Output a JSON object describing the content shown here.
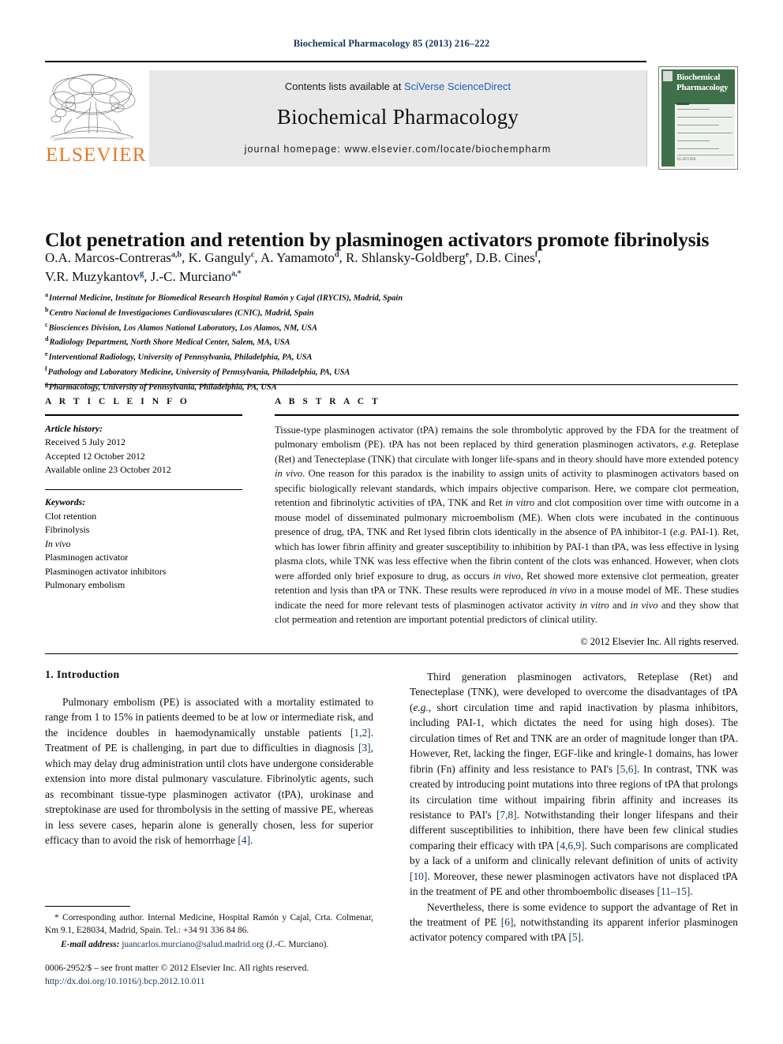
{
  "runhead": "Biochemical Pharmacology 85 (2013) 216–222",
  "masthead": {
    "contents_prefix": "Contents lists available at ",
    "contents_link": "SciVerse ScienceDirect",
    "journal_title": "Biochemical Pharmacology",
    "homepage": "journal homepage: www.elsevier.com/locate/biochempharm",
    "publisher_wordmark": "ELSEVIER",
    "publisher_logo_color": "#e87722"
  },
  "cover": {
    "title_line1": "Biochemical",
    "title_line2": "Pharmacology",
    "accent_color": "#3f7049",
    "imprint": "ELSEVIER"
  },
  "article": {
    "title": "Clot penetration and retention by plasminogen activators promote fibrinolysis",
    "authors_line1_names": [
      {
        "name": "O.A. Marcos-Contreras",
        "sup": "a,b"
      },
      {
        "name": "K. Ganguly",
        "sup": "c"
      },
      {
        "name": "A. Yamamoto",
        "sup": "d"
      },
      {
        "name": "R. Shlansky-Goldberg",
        "sup": "e"
      },
      {
        "name": "D.B. Cines",
        "sup": "f"
      }
    ],
    "authors_line2_names": [
      {
        "name": "V.R. Muzykantov",
        "sup": "g"
      },
      {
        "name": "J.-C. Murciano",
        "sup": "a,*"
      }
    ],
    "affiliations": [
      {
        "mark": "a",
        "text": "Internal Medicine, Institute for Biomedical Research Hospital Ramón y Cajal (IRYCIS), Madrid, Spain"
      },
      {
        "mark": "b",
        "text": "Centro Nacional de Investigaciones Cardiovasculares (CNIC), Madrid, Spain"
      },
      {
        "mark": "c",
        "text": "Biosciences Division, Los Alamos National Laboratory, Los Alamos, NM, USA"
      },
      {
        "mark": "d",
        "text": "Radiology Department, North Shore Medical Center, Salem, MA, USA"
      },
      {
        "mark": "e",
        "text": "Interventional Radiology, University of Pennsylvania, Philadelphia, PA, USA"
      },
      {
        "mark": "f",
        "text": "Pathology and Laboratory Medicine, University of Pennsylvania, Philadelphia, PA, USA"
      },
      {
        "mark": "g",
        "text": "Pharmacology, University of Pennsylvania, Philadelphia, PA, USA"
      }
    ]
  },
  "info": {
    "heading": "A R T I C L E  I N F O",
    "history_label": "Article history:",
    "history": [
      "Received 5 July 2012",
      "Accepted 12 October 2012",
      "Available online 23 October 2012"
    ],
    "keywords_label": "Keywords:",
    "keywords": [
      "Clot retention",
      "Fibrinolysis",
      "In vivo",
      "Plasminogen activator",
      "Plasminogen activator inhibitors",
      "Pulmonary embolism"
    ]
  },
  "abstract": {
    "heading": "A B S T R A C T",
    "text": "Tissue-type plasminogen activator (tPA) remains the sole thrombolytic approved by the FDA for the treatment of pulmonary embolism (PE). tPA has not been replaced by third generation plasminogen activators, e.g. Reteplase (Ret) and Tenecteplase (TNK) that circulate with longer life-spans and in theory should have more extended potency in vivo. One reason for this paradox is the inability to assign units of activity to plasminogen activators based on specific biologically relevant standards, which impairs objective comparison. Here, we compare clot permeation, retention and fibrinolytic activities of tPA, TNK and Ret in vitro and clot composition over time with outcome in a mouse model of disseminated pulmonary microembolism (ME). When clots were incubated in the continuous presence of drug, tPA, TNK and Ret lysed fibrin clots identically in the absence of PA inhibitor-1 (e.g. PAI-1). Ret, which has lower fibrin affinity and greater susceptibility to inhibition by PAI-1 than tPA, was less effective in lysing plasma clots, while TNK was less effective when the fibrin content of the clots was enhanced. However, when clots were afforded only brief exposure to drug, as occurs in vivo, Ret showed more extensive clot permeation, greater retention and lysis than tPA or TNK. These results were reproduced in vivo in a mouse model of ME. These studies indicate the need for more relevant tests of plasminogen activator activity in vitro and in vivo and they show that clot permeation and retention are important potential predictors of clinical utility.",
    "copyright": "© 2012 Elsevier Inc. All rights reserved."
  },
  "body": {
    "section1_heading": "1. Introduction",
    "left_paragraphs": [
      "Pulmonary embolism (PE) is associated with a mortality estimated to range from 1 to 15% in patients deemed to be at low or intermediate risk, and the incidence doubles in haemodynamically unstable patients [1,2]. Treatment of PE is challenging, in part due to difficulties in diagnosis [3], which may delay drug administration until clots have undergone considerable extension into more distal pulmonary vasculature. Fibrinolytic agents, such as recombinant tissue-type plasminogen activator (tPA), urokinase and streptokinase are used for thrombolysis in the setting of massive PE, whereas in less severe cases, heparin alone is generally chosen, less for superior efficacy than to avoid the risk of hemorrhage [4]."
    ],
    "right_paragraphs": [
      "Third generation plasminogen activators, Reteplase (Ret) and Tenecteplase (TNK), were developed to overcome the disadvantages of tPA (e.g., short circulation time and rapid inactivation by plasma inhibitors, including PAI-1, which dictates the need for using high doses). The circulation times of Ret and TNK are an order of magnitude longer than tPA. However, Ret, lacking the finger, EGF-like and kringle-1 domains, has lower fibrin (Fn) affinity and less resistance to PAI's [5,6]. In contrast, TNK was created by introducing point mutations into three regions of tPA that prolongs its circulation time without impairing fibrin affinity and increases its resistance to PAI's [7,8]. Notwithstanding their longer lifespans and their different susceptibilities to inhibition, there have been few clinical studies comparing their efficacy with tPA [4,6,9]. Such comparisons are complicated by a lack of a uniform and clinically relevant definition of units of activity [10]. Moreover, these newer plasminogen activators have not displaced tPA in the treatment of PE and other thromboembolic diseases [11–15].",
      "Nevertheless, there is some evidence to support the advantage of Ret in the treatment of PE [6], notwithstanding its apparent inferior plasminogen activator potency compared with tPA [5]."
    ]
  },
  "footnote": {
    "corresponding": "* Corresponding author. Internal Medicine, Hospital Ramón y Cajal, Crta. Colmenar, Km 9.1, E28034, Madrid, Spain. Tel.: +34 91 336 84 86.",
    "email_label": "E-mail address:",
    "email": "juancarlos.murciano@salud.madrid.org",
    "email_owner": "(J.-C. Murciano)."
  },
  "pagefoot": {
    "issn_line": "0006-2952/$ – see front matter © 2012 Elsevier Inc. All rights reserved.",
    "doi": "http://dx.doi.org/10.1016/j.bcp.2012.10.011"
  }
}
